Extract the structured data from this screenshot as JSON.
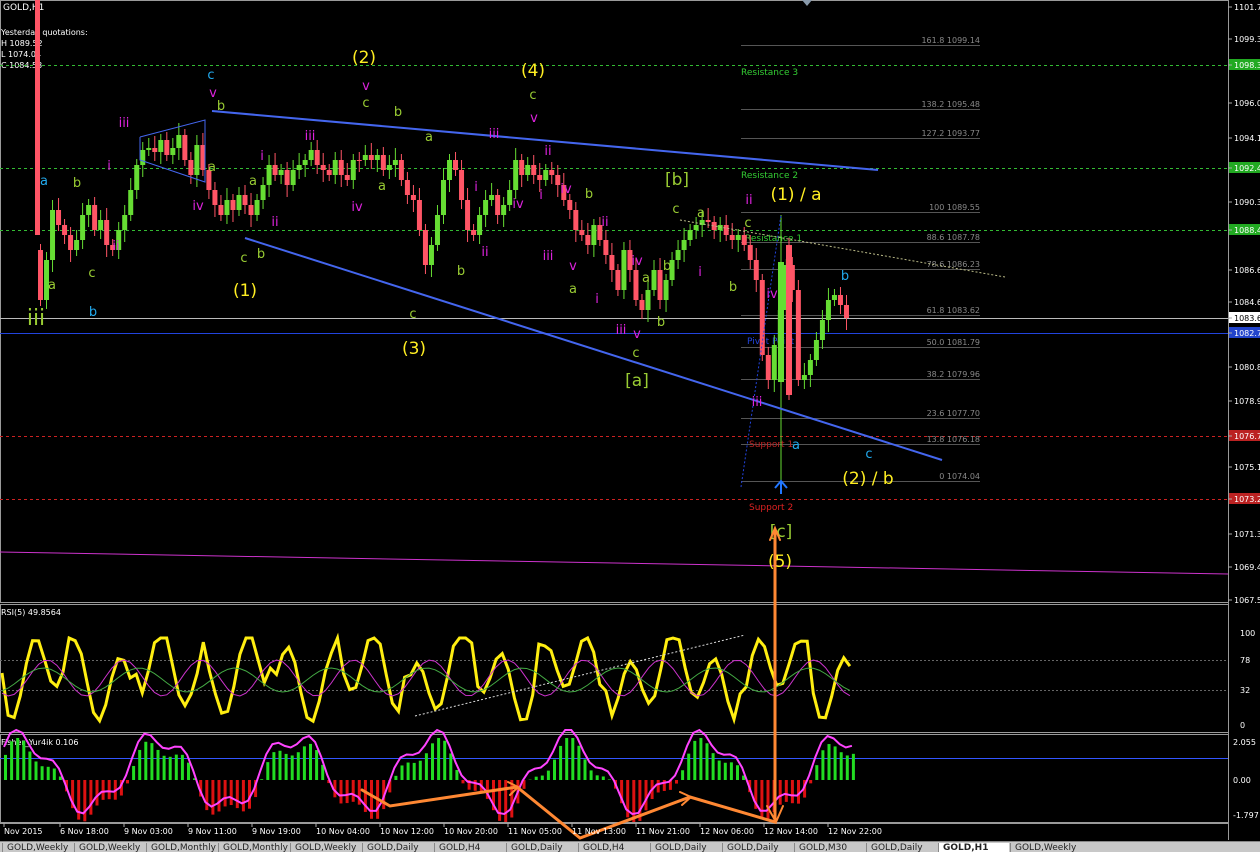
{
  "window": {
    "symbol": "GOLD,H1"
  },
  "quotes": {
    "heading": "Yesterday quotations:",
    "high": "H 1089.52",
    "low": "L 1074.04",
    "close": "C 1084.53"
  },
  "price_axis": {
    "labels": [
      "1101.70",
      "1099.38",
      "1098.3",
      "1096.00",
      "1094.10",
      "1092.4",
      "1090.30",
      "1088.4",
      "1086.60",
      "1084.60",
      "1083.6",
      "1082.7",
      "1080.80",
      "1078.90",
      "1076.7",
      "1075.10",
      "1073.2",
      "1071.30",
      "1069.40",
      "1067.50"
    ],
    "current_price": "1083.6",
    "pivot_value": "1082.7",
    "support1_value": "1076.7",
    "support2_value": "1073.2",
    "res2_value": "1092.4",
    "res1_value": "1088.4",
    "res3_value": "1098.3"
  },
  "levels": {
    "resistance3": "Resistance 3",
    "resistance2": "Resistance 2",
    "resistance1": "Resistance 1",
    "pivot": "Pivot Point",
    "support1": "Support 1",
    "support2": "Support 2"
  },
  "fib": [
    "161.8 1099.14",
    "138.2 1095.48",
    "127.2 1093.77",
    "100 1089.55",
    "88.6 1087.78",
    "78.6 1086.23",
    "61.8 1083.62",
    "50.0 1081.79",
    "38.2 1079.96",
    "23.6 1077.70",
    "13.8 1076.18",
    "0 1074.04"
  ],
  "rsi": {
    "title": "RSI(5) 49.8564",
    "labels": [
      "100",
      "78",
      "32",
      "0"
    ]
  },
  "fisher": {
    "title": "Fisher_Yur4ik 0.106",
    "labels": [
      "2.055",
      "0.00",
      "-1.797"
    ]
  },
  "time_axis": [
    "Nov 2015",
    "6 Nov 18:00",
    "9 Nov 03:00",
    "9 Nov 11:00",
    "9 Nov 19:00",
    "10 Nov 04:00",
    "10 Nov 12:00",
    "10 Nov 20:00",
    "11 Nov 05:00",
    "11 Nov 13:00",
    "11 Nov 21:00",
    "12 Nov 06:00",
    "12 Nov 14:00",
    "12 Nov 22:00"
  ],
  "wave_labels": {
    "iii_big": "iii",
    "c": "c",
    "a": "a",
    "b": "b",
    "v": "v",
    "i": "i",
    "ii": "ii",
    "iii": "iii",
    "iv": "iv",
    "w1": "(1)",
    "w2": "(2)",
    "w3": "(3)",
    "w4": "(4)",
    "w5": "(5)",
    "wa": "[a]",
    "wb": "[b]",
    "wc": "[c]",
    "w1a": "(1) / a",
    "w2b": "(2) / b"
  },
  "tabs": [
    "GOLD,Weekly",
    "GOLD,Weekly",
    "GOLD,Monthly",
    "GOLD,Monthly",
    "GOLD,Weekly",
    "GOLD,Daily",
    "GOLD,H4",
    "GOLD,Daily",
    "GOLD,H4",
    "GOLD,Daily",
    "GOLD,Daily",
    "GOLD,M30",
    "GOLD,Daily",
    "GOLD,H1",
    "GOLD,Weekly"
  ],
  "active_tab_index": 13,
  "colors": {
    "bull": "#66dd33",
    "bear": "#ff5566",
    "trendline": "#4466ee",
    "wave_yellow": "#ffee22",
    "wave_green": "#99cc33",
    "wave_magenta": "#dd22dd",
    "wave_cyan": "#22aaee",
    "rsi": "#ffee11",
    "arrow": "#ff8833"
  }
}
